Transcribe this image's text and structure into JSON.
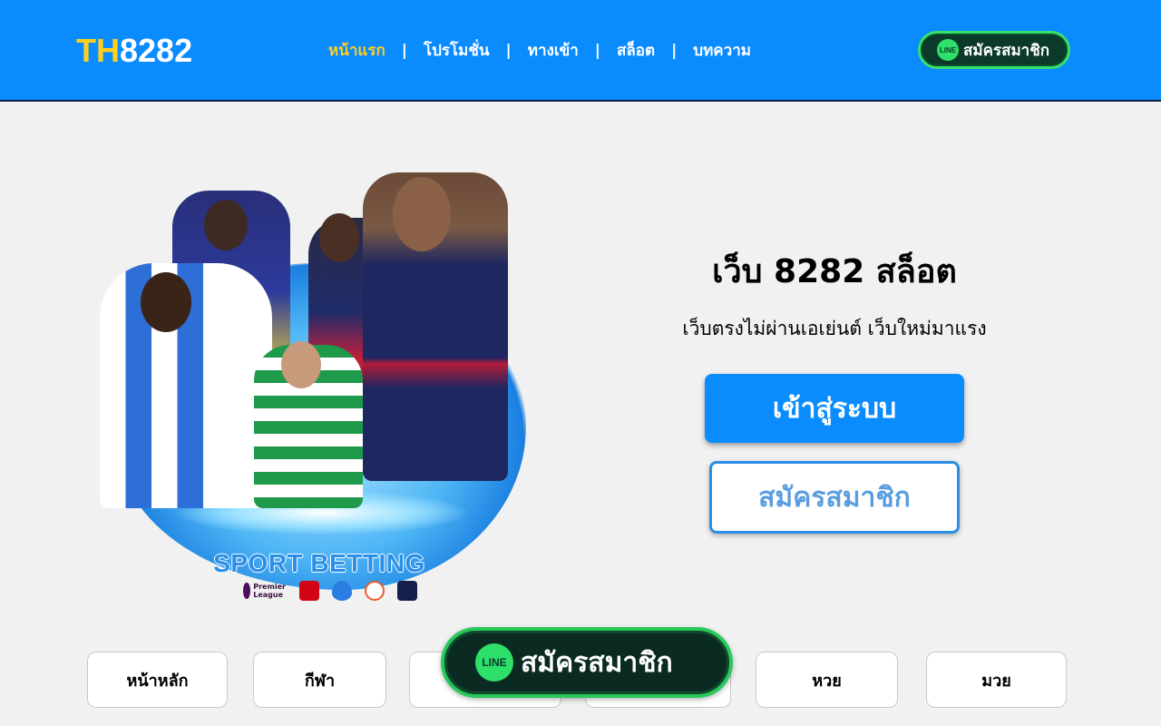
{
  "header": {
    "logo_th": "TH",
    "logo_num": "8282",
    "nav": [
      {
        "label": "หน้าแรก",
        "active": true
      },
      {
        "label": "โปรโมชั่น"
      },
      {
        "label": "ทางเข้า"
      },
      {
        "label": "สล็อต"
      },
      {
        "label": "บทความ"
      }
    ],
    "separator": "|",
    "line_badge": "LINE",
    "line_register_label": "สมัครสมาชิก"
  },
  "hero": {
    "banner_title": "SPORT BETTING",
    "league_premier": "Premier League",
    "title": "เว็บ 8282 สล็อต",
    "subtitle": "เว็บตรงไม่ผ่านเอเย่นต์ เว็บใหม่มาแรง",
    "login_label": "เข้าสู่ระบบ",
    "register_label": "สมัครสมาชิก"
  },
  "tabs": [
    {
      "label": "หน้าหลัก"
    },
    {
      "label": "กีฬา"
    },
    {
      "label": ""
    },
    {
      "label": ""
    },
    {
      "label": "หวย"
    },
    {
      "label": "มวย"
    }
  ],
  "floating_line": {
    "badge": "LINE",
    "label": "สมัครสมาชิก"
  },
  "colors": {
    "header_bg": "#0a8cff",
    "accent_yellow": "#ffcf1f",
    "line_green": "#28c85a",
    "page_bg": "#f1f1f1"
  }
}
